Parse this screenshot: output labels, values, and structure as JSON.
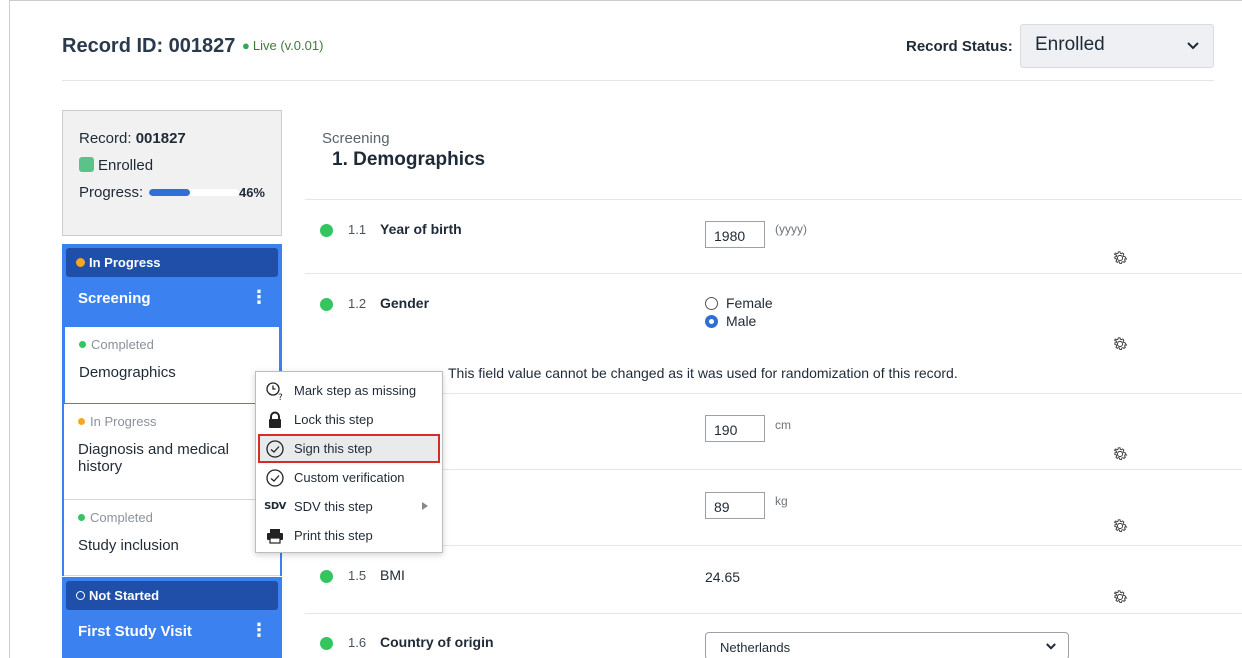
{
  "header": {
    "record_id_label": "Record ID: 001827",
    "live_label": "Live (v.0.01)",
    "status_label": "Record Status:",
    "status_value": "Enrolled"
  },
  "summary": {
    "record_prefix": "Record: ",
    "record_number": "001827",
    "enrolled_label": "Enrolled",
    "progress_label": "Progress:",
    "progress_percent": 46,
    "progress_text": "46%",
    "enrolled_color": "#5bc38a"
  },
  "phases": [
    {
      "status": "In Progress",
      "title": "Screening",
      "status_color": "#f5a623"
    },
    {
      "status": "Not Started",
      "title": "First Study Visit",
      "status_color": "#ffffff"
    }
  ],
  "steps": [
    {
      "status": "Completed",
      "name": "Demographics",
      "color": "#34c460"
    },
    {
      "status": "In Progress",
      "name": "Diagnosis and medical history",
      "color": "#f5a623"
    },
    {
      "status": "Completed",
      "name": "Study inclusion",
      "color": "#34c460"
    }
  ],
  "form": {
    "section": "Screening",
    "title": "1. Demographics",
    "q1": {
      "num": "1.1",
      "label": "Year of birth",
      "value": "1980",
      "unit": "(yyyy)"
    },
    "q2": {
      "num": "1.2",
      "label": "Gender",
      "options": [
        "Female",
        "Male"
      ],
      "selected": "Male"
    },
    "notice": "This field value cannot be changed as it was used for randomization of this record.",
    "q3": {
      "value": "190",
      "unit": "cm"
    },
    "q4": {
      "value": "89",
      "unit": "kg"
    },
    "q5": {
      "num": "1.5",
      "label": "BMI",
      "value": "24.65"
    },
    "q6": {
      "num": "1.6",
      "label": "Country of origin",
      "value": "Netherlands"
    }
  },
  "context_menu": {
    "items": [
      {
        "label": "Mark step as missing",
        "icon": "clock-question-icon"
      },
      {
        "label": "Lock this step",
        "icon": "lock-icon"
      },
      {
        "label": "Sign this step",
        "icon": "check-circle-icon",
        "highlighted": true
      },
      {
        "label": "Custom verification",
        "icon": "check-circle-icon"
      },
      {
        "label": "SDV this step",
        "icon": "sdv-check-icon",
        "submenu": true,
        "icon_text": "SDV"
      },
      {
        "label": "Print this step",
        "icon": "printer-icon"
      }
    ]
  },
  "colors": {
    "accent": "#3b82f0",
    "accent_dark": "#1f4fa8",
    "highlight_border": "#d62b2b",
    "field_dot": "#34c460"
  }
}
